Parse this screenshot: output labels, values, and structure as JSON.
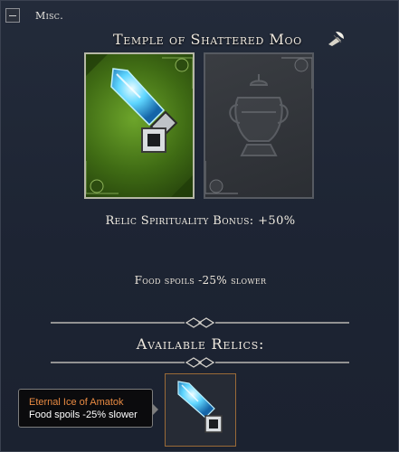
{
  "header": {
    "section_label": "Misc.",
    "temple_title": "Temple of Shattered Moo"
  },
  "temple": {
    "bonus_text": "Relic Spirituality Bonus: +50%",
    "effect_text": "Food spoils -25% slower"
  },
  "relics": {
    "heading": "Available Relics:"
  },
  "tooltip": {
    "name": "Eternal Ice of Amatok",
    "description": "Food spoils -25% slower"
  },
  "icons": {
    "collapse": "collapse-icon",
    "quill": "quill-icon",
    "relic_active": "ice-crystal-relic-icon",
    "relic_placeholder": "urn-placeholder-icon"
  },
  "colors": {
    "tooltip_name": "#e88a42",
    "active_card": "#6da52b",
    "slot_border": "#9a6a37"
  }
}
